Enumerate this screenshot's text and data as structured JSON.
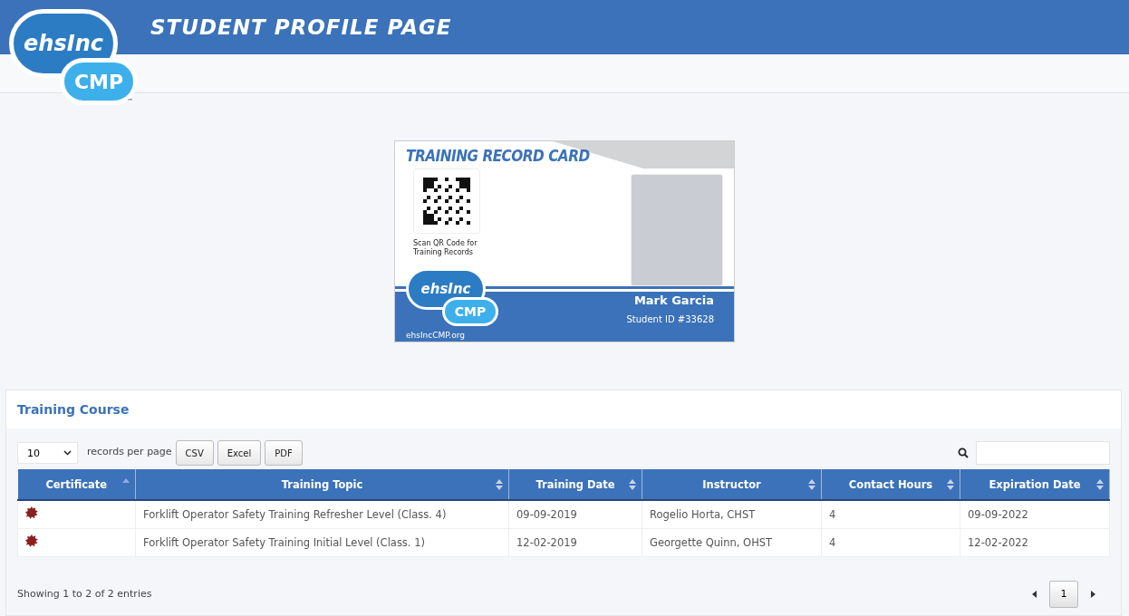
{
  "header": {
    "logo_top": "ehsInc",
    "logo_bottom": "CMP",
    "logo_mark": "™",
    "title": "STUDENT PROFILE PAGE"
  },
  "card": {
    "title": "TRAINING RECORD CARD",
    "qr_caption": "Scan QR Code for Training Records",
    "logo_top": "ehsInc",
    "logo_bottom": "CMP",
    "website": "ehsIncCMP.org",
    "name": "Mark Garcia",
    "student_id": "Student ID #33628"
  },
  "panel": {
    "title": "Training Course",
    "page_size": "10",
    "page_size_label": "records per page",
    "export_buttons": [
      "CSV",
      "Excel",
      "PDF"
    ],
    "columns": [
      {
        "label": "Certificate",
        "sorted": true
      },
      {
        "label": "Training Topic",
        "sorted": false
      },
      {
        "label": "Training Date",
        "sorted": false
      },
      {
        "label": "Instructor",
        "sorted": false
      },
      {
        "label": "Contact Hours",
        "sorted": false
      },
      {
        "label": "Expiration Date",
        "sorted": false
      }
    ],
    "rows": [
      {
        "certificate": true,
        "training_topic": "Forklift Operator Safety Training Refresher Level (Class. 4)",
        "training_date": "09-09-2019",
        "instructor": "Rogelio Horta, CHST",
        "contact_hours": "4",
        "expiration_date": "09-09-2022"
      },
      {
        "certificate": true,
        "training_topic": "Forklift Operator Safety Training Initial Level (Class. 1)",
        "training_date": "12-02-2019",
        "instructor": "Georgette Quinn, OHST",
        "contact_hours": "4",
        "expiration_date": "12-02-2022"
      }
    ],
    "info": "Showing 1 to 2 of 2 entries",
    "pages": [
      {
        "label": "1",
        "selected": true
      }
    ]
  }
}
